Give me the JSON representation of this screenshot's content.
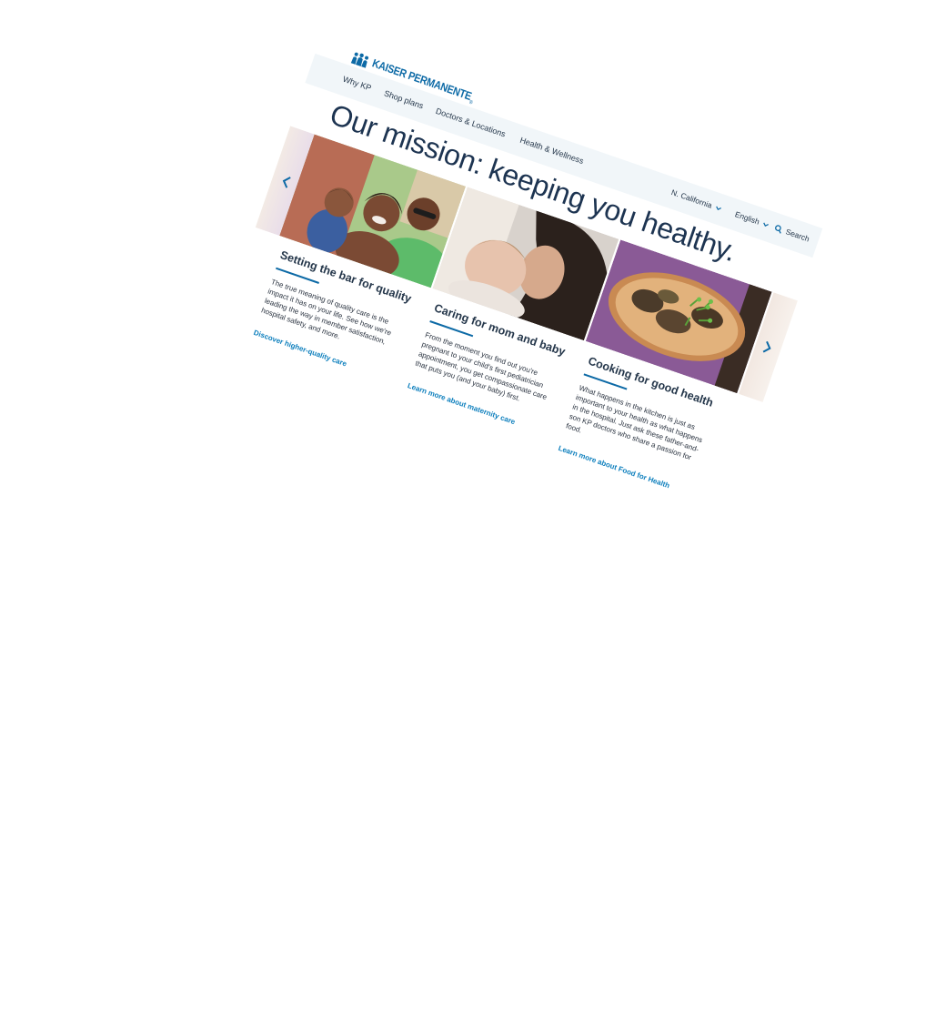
{
  "brand": {
    "name": "KAISER PERMANENTE",
    "registered_mark": "®",
    "color": "#0d6aa6"
  },
  "nav": {
    "items": [
      {
        "label": "Why KP"
      },
      {
        "label": "Shop plans"
      },
      {
        "label": "Doctors & Locations"
      },
      {
        "label": "Health & Wellness"
      }
    ],
    "region": {
      "label": "N. California",
      "icon": "chevron-down-icon"
    },
    "language": {
      "label": "English",
      "icon": "chevron-down-icon"
    },
    "search": {
      "label": "Search",
      "icon": "search-icon"
    }
  },
  "hero": {
    "headline": "Our mission: keeping you healthy."
  },
  "carousel": {
    "prev_icon": "chevron-left-icon",
    "next_icon": "chevron-right-icon",
    "accent_color": "#0d6aa6"
  },
  "cards": [
    {
      "title": "Setting the bar for quality",
      "body": "The true meaning of quality care is the impact it has on your life. See how we're leading the way in member satisfaction, hospital safety, and more.",
      "link": "Discover higher-quality care"
    },
    {
      "title": "Caring for mom and baby",
      "body": "From the moment you find out you're pregnant to your child's first pediatrician appointment, you get compassionate care that puts you (and your baby) first.",
      "link": "Learn more about maternity care"
    },
    {
      "title": "Cooking for good health",
      "body": "What happens in the kitchen is just as important to your health as what happens in the hospital. Just ask these father-and-son KP doctors who share a passion for food.",
      "link": "Learn more about Food for Health"
    }
  ]
}
